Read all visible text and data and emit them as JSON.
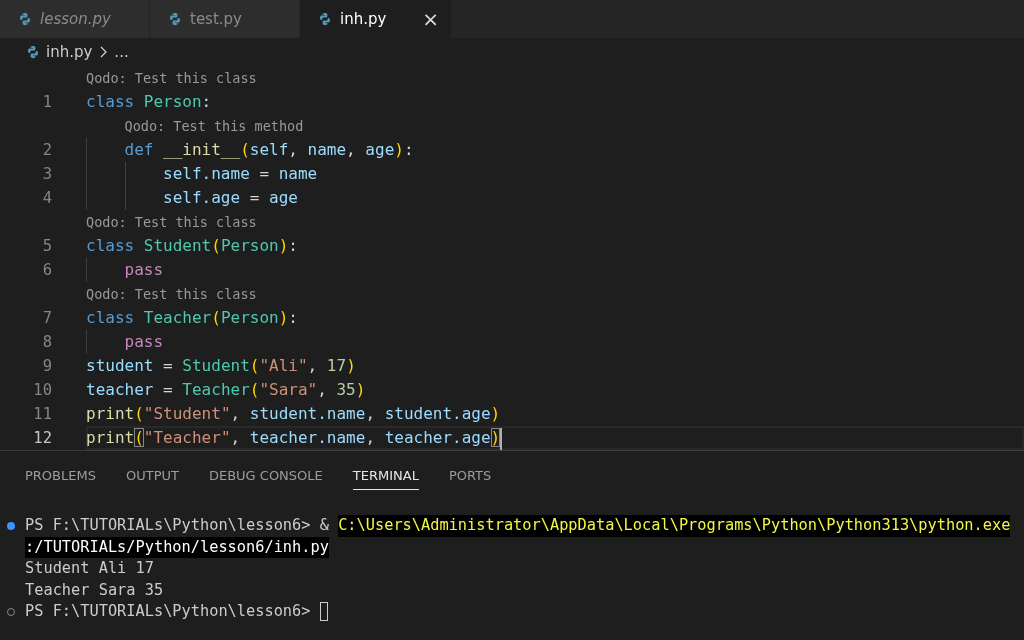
{
  "tabs": [
    {
      "label": "lesson.py",
      "selected": false,
      "preview": true
    },
    {
      "label": "test.py",
      "selected": false,
      "preview": false
    },
    {
      "label": "inh.py",
      "selected": true,
      "preview": false,
      "close": "×"
    }
  ],
  "breadcrumb": {
    "file": "inh.py",
    "more": "..."
  },
  "editor": {
    "lines": [
      {
        "number": "1",
        "codelens": "Qodo: Test this class",
        "current": false,
        "tokens": [
          {
            "kind": "keyword",
            "text": "class "
          },
          {
            "kind": "type",
            "text": "Person"
          },
          {
            "kind": "plain",
            "text": ":"
          }
        ]
      },
      {
        "number": "2",
        "codelens": "Qodo: Test this method",
        "current": false,
        "tokens": [
          {
            "kind": "keyword",
            "text": "    def "
          },
          {
            "kind": "func",
            "text": "__init__"
          },
          {
            "kind": "bracket",
            "text": "("
          },
          {
            "kind": "var",
            "text": "self"
          },
          {
            "kind": "plain",
            "text": ", "
          },
          {
            "kind": "var",
            "text": "name"
          },
          {
            "kind": "plain",
            "text": ", "
          },
          {
            "kind": "var",
            "text": "age"
          },
          {
            "kind": "bracket",
            "text": ")"
          },
          {
            "kind": "plain",
            "text": ":"
          }
        ]
      },
      {
        "number": "3",
        "current": false,
        "tokens": [
          {
            "kind": "var",
            "text": "        self.name"
          },
          {
            "kind": "plain",
            "text": " = "
          },
          {
            "kind": "var",
            "text": "name"
          }
        ]
      },
      {
        "number": "4",
        "current": false,
        "tokens": [
          {
            "kind": "var",
            "text": "        self.age"
          },
          {
            "kind": "plain",
            "text": " = "
          },
          {
            "kind": "var",
            "text": "age"
          }
        ]
      },
      {
        "number": "5",
        "codelens": "Qodo: Test this class",
        "current": false,
        "tokens": [
          {
            "kind": "keyword",
            "text": "class "
          },
          {
            "kind": "type",
            "text": "Student"
          },
          {
            "kind": "bracket",
            "text": "("
          },
          {
            "kind": "type",
            "text": "Person"
          },
          {
            "kind": "bracket",
            "text": ")"
          },
          {
            "kind": "plain",
            "text": ":"
          }
        ]
      },
      {
        "number": "6",
        "current": false,
        "tokens": [
          {
            "kind": "control",
            "text": "    pass"
          }
        ]
      },
      {
        "number": "7",
        "codelens": "Qodo: Test this class",
        "current": false,
        "tokens": [
          {
            "kind": "keyword",
            "text": "class "
          },
          {
            "kind": "type",
            "text": "Teacher"
          },
          {
            "kind": "bracket",
            "text": "("
          },
          {
            "kind": "type",
            "text": "Person"
          },
          {
            "kind": "bracket",
            "text": ")"
          },
          {
            "kind": "plain",
            "text": ":"
          }
        ]
      },
      {
        "number": "8",
        "current": false,
        "tokens": [
          {
            "kind": "control",
            "text": "    pass"
          }
        ]
      },
      {
        "number": "9",
        "current": false,
        "tokens": [
          {
            "kind": "var",
            "text": "student"
          },
          {
            "kind": "plain",
            "text": " = "
          },
          {
            "kind": "type",
            "text": "Student"
          },
          {
            "kind": "bracket",
            "text": "("
          },
          {
            "kind": "string",
            "text": "\"Ali\""
          },
          {
            "kind": "plain",
            "text": ", "
          },
          {
            "kind": "number",
            "text": "17"
          },
          {
            "kind": "bracket",
            "text": ")"
          }
        ]
      },
      {
        "number": "10",
        "current": false,
        "tokens": [
          {
            "kind": "var",
            "text": "teacher"
          },
          {
            "kind": "plain",
            "text": " = "
          },
          {
            "kind": "type",
            "text": "Teacher"
          },
          {
            "kind": "bracket",
            "text": "("
          },
          {
            "kind": "string",
            "text": "\"Sara\""
          },
          {
            "kind": "plain",
            "text": ", "
          },
          {
            "kind": "number",
            "text": "35"
          },
          {
            "kind": "bracket",
            "text": ")"
          }
        ]
      },
      {
        "number": "11",
        "current": false,
        "tokens": [
          {
            "kind": "func",
            "text": "print"
          },
          {
            "kind": "bracket",
            "text": "("
          },
          {
            "kind": "string",
            "text": "\"Student\""
          },
          {
            "kind": "plain",
            "text": ", "
          },
          {
            "kind": "var",
            "text": "student.name"
          },
          {
            "kind": "plain",
            "text": ", "
          },
          {
            "kind": "var",
            "text": "student.age"
          },
          {
            "kind": "bracket",
            "text": ")"
          }
        ]
      },
      {
        "number": "12",
        "current": true,
        "tokens": [
          {
            "kind": "func",
            "text": "print"
          },
          {
            "kind": "match",
            "text": "("
          },
          {
            "kind": "string",
            "text": "\"Teacher\""
          },
          {
            "kind": "plain",
            "text": ", "
          },
          {
            "kind": "var",
            "text": "teacher.name"
          },
          {
            "kind": "plain",
            "text": ", "
          },
          {
            "kind": "var",
            "text": "teacher.age"
          },
          {
            "kind": "match",
            "text": ")"
          }
        ]
      }
    ]
  },
  "panel": {
    "tabs": [
      {
        "label": "PROBLEMS",
        "selected": false
      },
      {
        "label": "OUTPUT",
        "selected": false
      },
      {
        "label": "DEBUG CONSOLE",
        "selected": false
      },
      {
        "label": "TERMINAL",
        "selected": true
      },
      {
        "label": "PORTS",
        "selected": false
      }
    ],
    "terminal": [
      {
        "prompt": true,
        "succeeded": true,
        "segments": [
          {
            "kind": "plain",
            "text": "PS F:\\TUTORIALs\\Python\\lesson6> & "
          },
          {
            "kind": "command",
            "text": "C:\\Users\\Administrator\\AppData\\Local\\Programs\\Python\\Python313\\python.exe"
          }
        ]
      },
      {
        "prompt": false,
        "segments": [
          {
            "kind": "selected",
            "text": ":/TUTORIALs/Python/lesson6/inh.py"
          }
        ]
      },
      {
        "prompt": false,
        "segments": [
          {
            "kind": "plain",
            "text": "Student Ali 17"
          }
        ]
      },
      {
        "prompt": false,
        "segments": [
          {
            "kind": "plain",
            "text": "Teacher Sara 35"
          }
        ]
      },
      {
        "prompt": true,
        "succeeded": false,
        "cursor": true,
        "segments": [
          {
            "kind": "plain",
            "text": "PS F:\\TUTORIALs\\Python\\lesson6> "
          }
        ]
      }
    ]
  }
}
